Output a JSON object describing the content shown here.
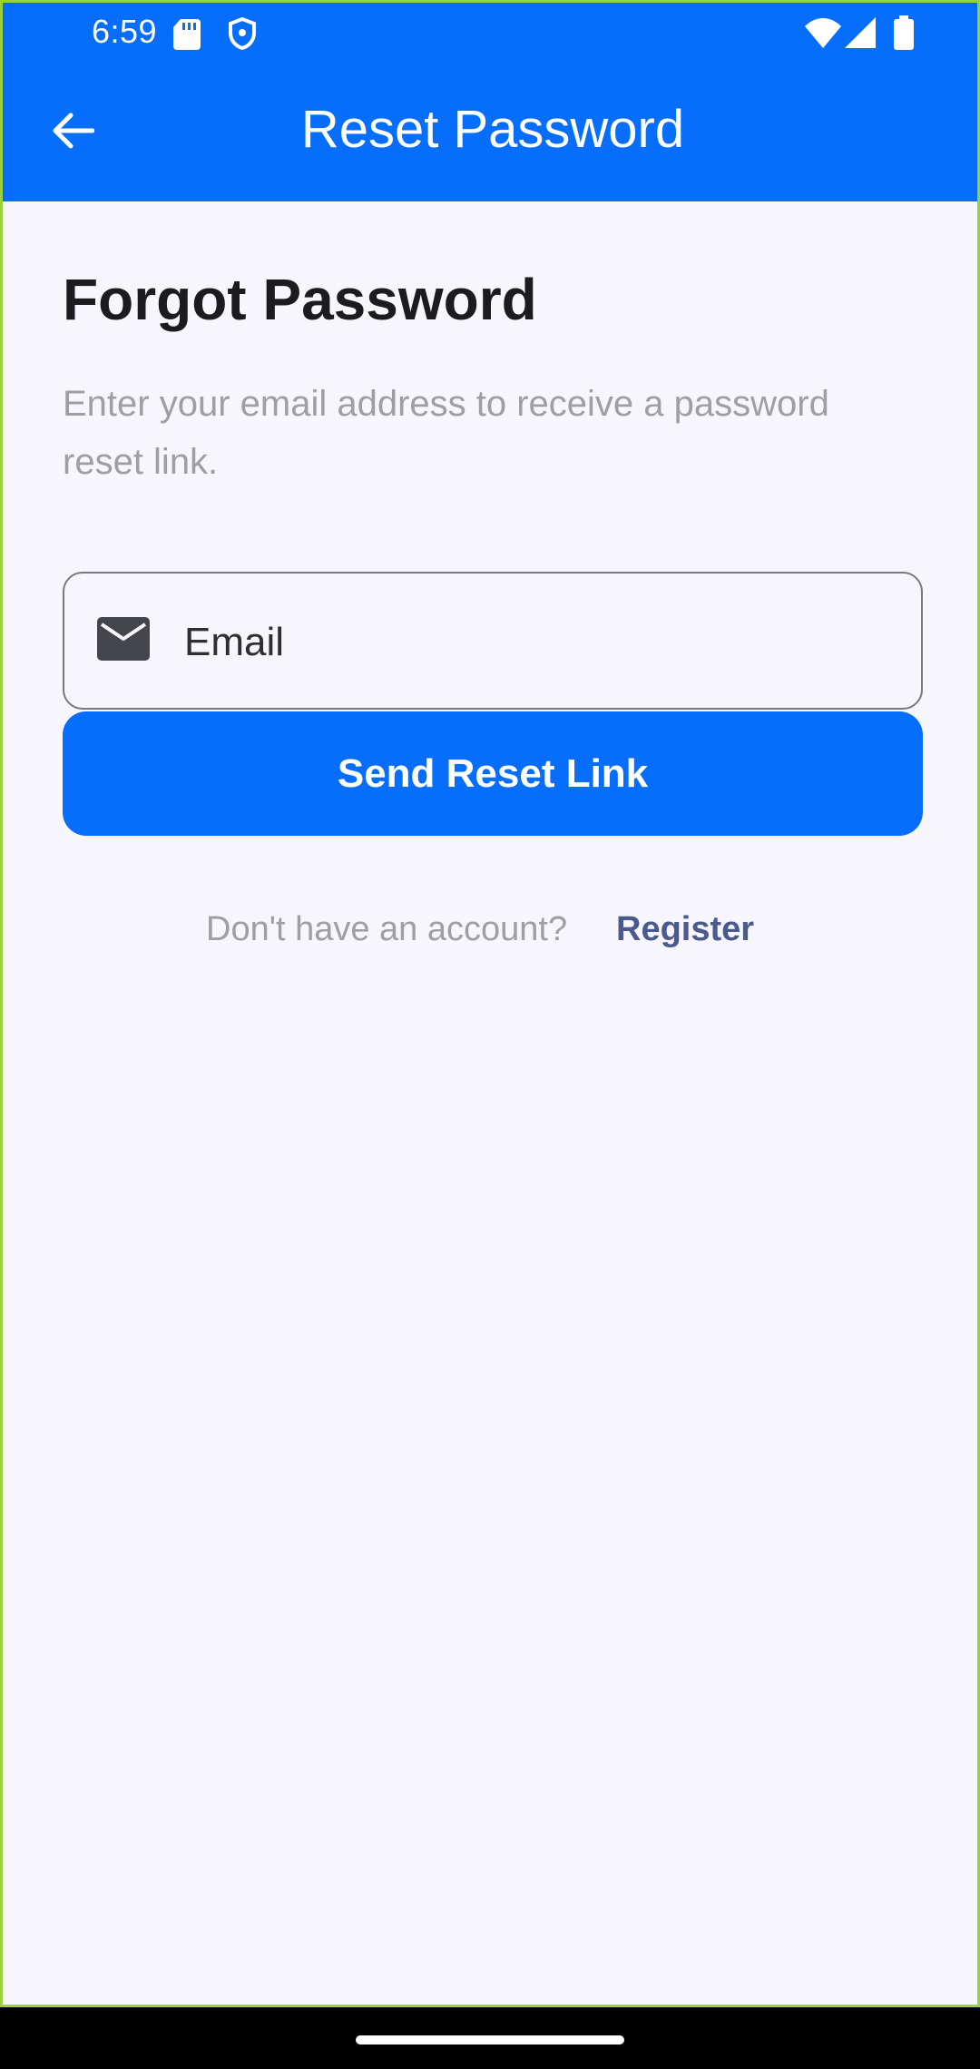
{
  "status_bar": {
    "time": "6:59",
    "icons": [
      "sd-card-icon",
      "shield-icon",
      "wifi-icon",
      "signal-icon",
      "battery-icon"
    ]
  },
  "app_bar": {
    "title": "Reset Password",
    "back_icon": "arrow-back-icon",
    "color": "#066EFA"
  },
  "content": {
    "heading": "Forgot Password",
    "subtext": "Enter your email address to receive a password reset link.",
    "email_field": {
      "icon": "mail-icon",
      "placeholder": "Email",
      "value": ""
    },
    "send_button_label": "Send Reset Link",
    "register_prompt": "Don't have an account?",
    "register_link": "Register"
  }
}
